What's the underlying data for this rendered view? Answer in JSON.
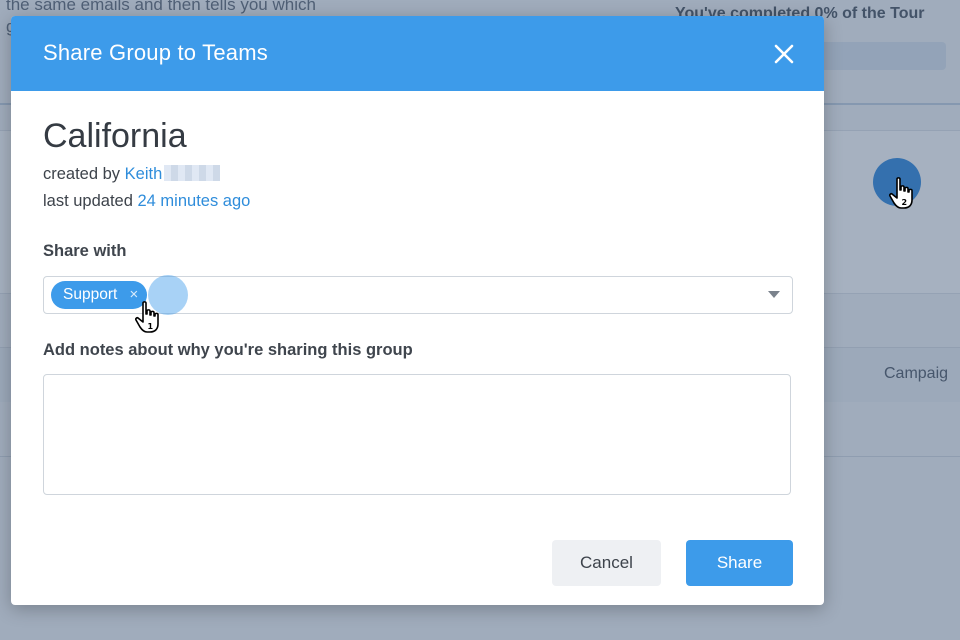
{
  "background": {
    "top_text_line1": "the same emails and then tells you which",
    "top_text_line2": "g",
    "tour_progress": "You've completed 0% of the Tour",
    "column_header": "Campaig"
  },
  "modal": {
    "title": "Share Group to Teams",
    "close_icon": "close-icon",
    "group_name": "California",
    "created_by_label": "created by",
    "created_by_user": "Keith",
    "last_updated_label": "last updated",
    "last_updated_value": "24 minutes ago",
    "share_with_label": "Share with",
    "selected_tags": [
      {
        "label": "Support",
        "remove_glyph": "×"
      }
    ],
    "notes_label": "Add notes about why you're sharing this group",
    "notes_value": "",
    "buttons": {
      "cancel": "Cancel",
      "share": "Share"
    }
  },
  "annotations": {
    "cursor_1_number": "1",
    "cursor_2_number": "2"
  },
  "colors": {
    "accent": "#3d9bea",
    "link": "#2f8ddb",
    "overlay": "#2c4669"
  }
}
